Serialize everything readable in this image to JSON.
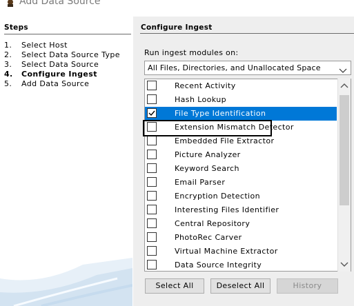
{
  "window": {
    "title": "Add Data Source"
  },
  "steps": {
    "heading": "Steps",
    "items": [
      {
        "num": "1.",
        "label": "Select Host",
        "active": false
      },
      {
        "num": "2.",
        "label": "Select Data Source Type",
        "active": false
      },
      {
        "num": "3.",
        "label": "Select Data Source",
        "active": false
      },
      {
        "num": "4.",
        "label": "Configure Ingest",
        "active": true
      },
      {
        "num": "5.",
        "label": "Add Data Source",
        "active": false
      }
    ]
  },
  "config": {
    "heading": "Configure Ingest",
    "run_label": "Run ingest modules on:",
    "run_selected": "All Files, Directories, and Unallocated Space",
    "modules": [
      {
        "label": "Recent Activity",
        "checked": false,
        "selected": false
      },
      {
        "label": "Hash Lookup",
        "checked": false,
        "selected": false
      },
      {
        "label": "File Type Identification",
        "checked": true,
        "selected": true
      },
      {
        "label": "Extension Mismatch Detector",
        "checked": false,
        "selected": false
      },
      {
        "label": "Embedded File Extractor",
        "checked": false,
        "selected": false
      },
      {
        "label": "Picture Analyzer",
        "checked": false,
        "selected": false
      },
      {
        "label": "Keyword Search",
        "checked": false,
        "selected": false
      },
      {
        "label": "Email Parser",
        "checked": false,
        "selected": false
      },
      {
        "label": "Encryption Detection",
        "checked": false,
        "selected": false
      },
      {
        "label": "Interesting Files Identifier",
        "checked": false,
        "selected": false
      },
      {
        "label": "Central Repository",
        "checked": false,
        "selected": false
      },
      {
        "label": "PhotoRec Carver",
        "checked": false,
        "selected": false
      },
      {
        "label": "Virtual Machine Extractor",
        "checked": false,
        "selected": false
      },
      {
        "label": "Data Source Integrity",
        "checked": false,
        "selected": false
      },
      {
        "label": "",
        "checked": false,
        "selected": false
      }
    ],
    "buttons": {
      "select_all": "Select All",
      "deselect_all": "Deselect All",
      "history": "History"
    }
  },
  "colors": {
    "selection": "#0078d7",
    "panel_bg": "#eeeeee",
    "disabled_text": "#8a8a8a"
  }
}
